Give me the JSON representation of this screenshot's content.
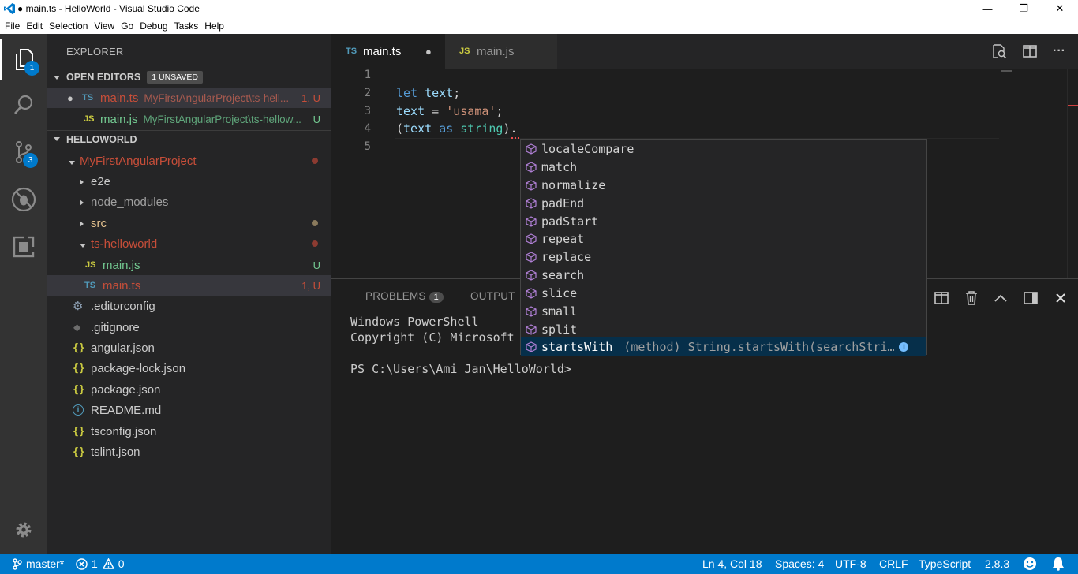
{
  "window": {
    "title": "● main.ts - HelloWorld - Visual Studio Code",
    "minimize": "—",
    "maximize": "❐",
    "close": "✕"
  },
  "menu": [
    "File",
    "Edit",
    "Selection",
    "View",
    "Go",
    "Debug",
    "Tasks",
    "Help"
  ],
  "activity": {
    "explorer_badge": "1",
    "scm_badge": "3"
  },
  "sidebar": {
    "title": "EXPLORER",
    "open_editors": {
      "header": "OPEN EDITORS",
      "badge": "1 UNSAVED",
      "items": [
        {
          "icon": "TS",
          "name": "main.ts",
          "path": "MyFirstAngularProject\\ts-hell...",
          "status": "1, U",
          "dirty": "●"
        },
        {
          "icon": "JS",
          "name": "main.js",
          "path": "MyFirstAngularProject\\ts-hellow...",
          "status": "U"
        }
      ]
    },
    "workspace": {
      "header": "HELLOWORLD",
      "items": [
        {
          "name": "MyFirstAngularProject"
        },
        {
          "name": "e2e"
        },
        {
          "name": "node_modules"
        },
        {
          "name": "src"
        },
        {
          "name": "ts-helloworld"
        },
        {
          "icon": "JS",
          "name": "main.js",
          "status": "U"
        },
        {
          "icon": "TS",
          "name": "main.ts",
          "status": "1, U"
        },
        {
          "name": ".editorconfig"
        },
        {
          "name": ".gitignore"
        },
        {
          "icon": "{}",
          "name": "angular.json"
        },
        {
          "icon": "{}",
          "name": "package-lock.json"
        },
        {
          "icon": "{}",
          "name": "package.json"
        },
        {
          "name": "README.md"
        },
        {
          "icon": "{}",
          "name": "tsconfig.json"
        },
        {
          "icon": "{}",
          "name": "tslint.json"
        }
      ]
    }
  },
  "tabs": [
    {
      "icon": "TS",
      "label": "main.ts",
      "dirty": "●"
    },
    {
      "icon": "JS",
      "label": "main.js"
    }
  ],
  "editor": {
    "line_numbers": [
      "1",
      "2",
      "3",
      "4",
      "5"
    ],
    "lines": {
      "l2": {
        "kw": "let",
        "var": "text",
        "end": ";"
      },
      "l3": {
        "var": "text",
        "op": " = ",
        "str": "'usama'",
        "end": ";"
      },
      "l4": {
        "open": "(",
        "var": "text",
        "kw": "as",
        "ty": "string",
        "end": ")."
      }
    }
  },
  "suggest": {
    "items": [
      "localeCompare",
      "match",
      "normalize",
      "padEnd",
      "padStart",
      "repeat",
      "replace",
      "search",
      "slice",
      "small",
      "split"
    ],
    "focused": {
      "label": "startsWith",
      "detail": "(method) String.startsWith(searchStri…",
      "info": "i"
    }
  },
  "panel": {
    "tabs": [
      {
        "label": "PROBLEMS",
        "badge": "1"
      },
      {
        "label": "OUTPUT"
      }
    ],
    "terminal": {
      "line1": "Windows PowerShell",
      "line2": "Copyright (C) Microsoft",
      "prompt": "PS C:\\Users\\Ami Jan\\HelloWorld>"
    }
  },
  "status": {
    "branch": "master*",
    "errors": "1",
    "warnings": "0",
    "position": "Ln 4, Col 18",
    "spaces": "Spaces: 4",
    "encoding": "UTF-8",
    "eol": "CRLF",
    "language": "TypeScript",
    "version": "2.8.3"
  },
  "colors": {
    "accent": "#007acc",
    "modified": "#c74e39",
    "untracked": "#73c991",
    "ts_icon": "#519aba",
    "js_icon": "#cbcb41"
  }
}
